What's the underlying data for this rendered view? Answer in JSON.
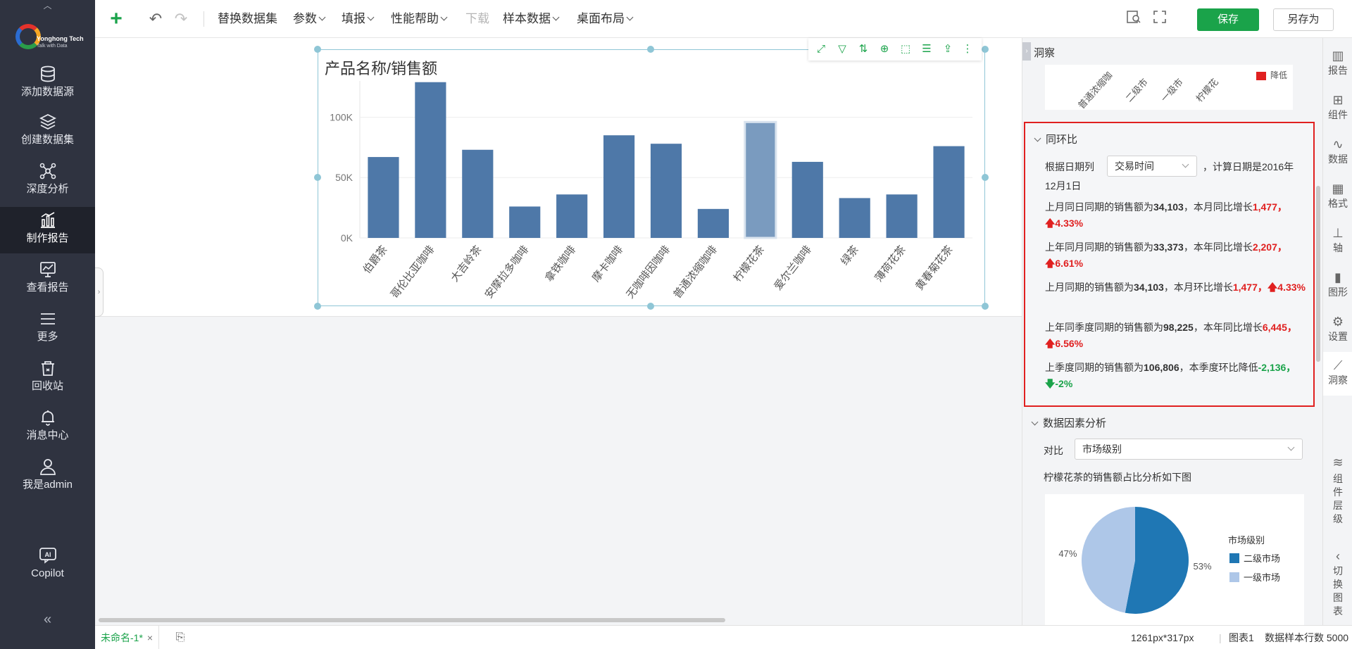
{
  "sidebar": {
    "logo_name": "Yonghong Tech",
    "logo_tagline": "Talk with Data",
    "items": [
      {
        "label": "添加数据源",
        "icon": "database-icon"
      },
      {
        "label": "创建数据集",
        "icon": "layers-icon"
      },
      {
        "label": "深度分析",
        "icon": "network-icon"
      },
      {
        "label": "制作报告",
        "icon": "bar-chart-icon",
        "active": true
      },
      {
        "label": "查看报告",
        "icon": "monitor-chart-icon"
      },
      {
        "label": "更多",
        "icon": "menu-icon"
      },
      {
        "label": "回收站",
        "icon": "trash-icon"
      },
      {
        "label": "消息中心",
        "icon": "bell-icon"
      },
      {
        "label": "我是admin",
        "icon": "user-icon"
      },
      {
        "label": "Copilot",
        "icon": "ai-icon"
      }
    ]
  },
  "toolbar": {
    "menus": [
      "替换数据集",
      "参数",
      "填报",
      "性能帮助",
      "下载",
      "样本数据",
      "桌面布局"
    ],
    "save_label": "保存",
    "saveas_label": "另存为"
  },
  "chart_data": {
    "type": "bar",
    "title": "产品名称/销售额",
    "categories": [
      "伯爵茶",
      "哥伦比亚咖啡",
      "大吉岭茶",
      "安摩拉多咖啡",
      "拿铁咖啡",
      "摩卡咖啡",
      "无咖啡因咖啡",
      "普通浓缩咖啡",
      "柠檬花茶",
      "爱尔兰咖啡",
      "绿茶",
      "薄荷花茶",
      "黄春菊花茶"
    ],
    "values": [
      67000,
      129000,
      73000,
      26000,
      36000,
      85000,
      78000,
      24000,
      96000,
      63000,
      33000,
      36000,
      76000
    ],
    "highlight_index": 8,
    "ylim": [
      0,
      130000
    ],
    "y_ticks": [
      {
        "value": 0,
        "label": "0K"
      },
      {
        "value": 50000,
        "label": "50K"
      },
      {
        "value": 100000,
        "label": "100K"
      }
    ],
    "bar_color": "#4e78a8",
    "highlight_color": "#7a9bbf"
  },
  "insight": {
    "header": "洞察",
    "mini_labels": [
      "普通浓缩咖",
      "二级市",
      "一级市",
      "柠檬花"
    ],
    "mini_legend": "降低",
    "yoy": {
      "title": "同环比",
      "date_label": "根据日期列",
      "date_select": "交易时间",
      "date_suffix": "，计算日期是2016年",
      "date_suffix2": "12月1日",
      "lines": [
        {
          "pre": "上月同日同期的销售额为",
          "value": "34,103",
          "mid": "，本月同比增长",
          "diff": "1,477，",
          "pct": "4.33%",
          "dir": "up"
        },
        {
          "pre": "上年同月同期的销售额为",
          "value": "33,373",
          "mid": "，本年同比增长",
          "diff": "2,207，",
          "pct": "6.61%",
          "dir": "up"
        },
        {
          "pre": "上月同期的销售额为",
          "value": "34,103",
          "mid": "，本月环比增长",
          "diff": "1,477，",
          "pct": "4.33%",
          "dir": "up"
        },
        {
          "pre": "上年同季度同期的销售额为",
          "value": "98,225",
          "mid": "，本年同比增长",
          "diff": "6,445，",
          "pct": "6.56%",
          "dir": "up"
        },
        {
          "pre": "上季度同期的销售额为",
          "value": "106,806",
          "mid": "，本季度环比降低",
          "diff": "-2,136，",
          "pct": "-2%",
          "dir": "down"
        }
      ]
    },
    "factor": {
      "title": "数据因素分析",
      "compare_label": "对比",
      "compare_select": "市场级别",
      "desc": "柠檬花茶的销售额占比分析如下图",
      "pie": {
        "legend_title": "市场级别",
        "slices": [
          {
            "name": "二级市场",
            "value": 53,
            "label": "53%",
            "color": "#1f77b4"
          },
          {
            "name": "一级市场",
            "value": 47,
            "label": "47%",
            "color": "#aec7e8"
          }
        ]
      }
    }
  },
  "iconbar": {
    "items": [
      "报告",
      "组件",
      "数据",
      "格式",
      "轴",
      "图形",
      "设置",
      "洞察"
    ],
    "vertical1": [
      "组",
      "件",
      "层",
      "级"
    ],
    "vertical2": [
      "切",
      "换",
      "图",
      "表"
    ]
  },
  "status": {
    "tab_label": "未命名-1*",
    "size_text": "1261px*317px",
    "chart_name": "图表1",
    "sample_rows": "数据样本行数 5000"
  }
}
